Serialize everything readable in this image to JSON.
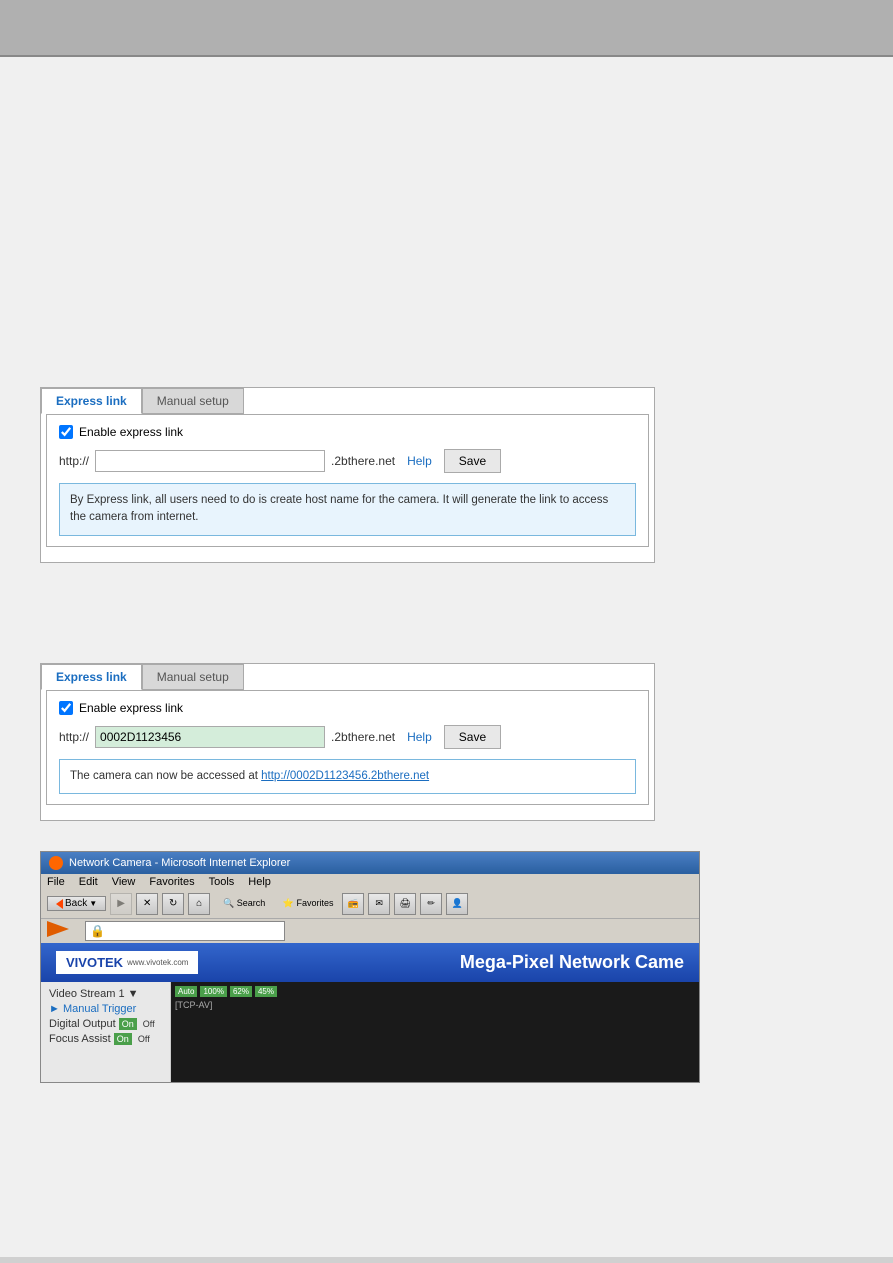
{
  "page": {
    "top_bar": "",
    "background_color": "#d0d0d0"
  },
  "section1": {
    "tab_express_label": "Express link",
    "tab_manual_label": "Manual setup",
    "enable_checkbox_label": "Enable express link",
    "http_prefix": "http://",
    "domain_suffix": ".2bthere.net",
    "help_label": "Help",
    "save_label": "Save",
    "input_placeholder": "",
    "input_value": "",
    "info_text": "By Express link, all users need to do is create host name for the camera. It will generate the link to access the camera from internet."
  },
  "section2": {
    "tab_express_label": "Express link",
    "tab_manual_label": "Manual setup",
    "enable_checkbox_label": "Enable express link",
    "http_prefix": "http://",
    "input_value": "0002D1123456",
    "domain_suffix": ".2bthere.net",
    "help_label": "Help",
    "save_label": "Save",
    "success_text_prefix": "The camera can now be accessed at ",
    "success_link": "http://0002D1123456.2bthere.net"
  },
  "browser": {
    "title": "Network Camera - Microsoft Internet Explorer",
    "icon_label": "ie-icon",
    "menu_items": [
      "File",
      "Edit",
      "View",
      "Favorites",
      "Tools",
      "Help"
    ],
    "back_label": "Back",
    "address_value": "",
    "address_icon": "🔒",
    "camera_title": "Mega-Pixel Network Came",
    "vivotek_text": "VIVOTEK",
    "vivotek_sub": "www.vivotek.com",
    "sidebar_items": [
      {
        "label": "Video Stream 1 ▼",
        "type": "select"
      },
      {
        "label": "► Manual Trigger",
        "type": "link"
      },
      {
        "label": "Digital Output On Off",
        "type": "control"
      },
      {
        "label": "Focus Assist On Off",
        "type": "control"
      }
    ],
    "tcp_av": "[TCP-AV]",
    "status_bars": [
      "Auto",
      "100%",
      "62%",
      "45%"
    ]
  }
}
